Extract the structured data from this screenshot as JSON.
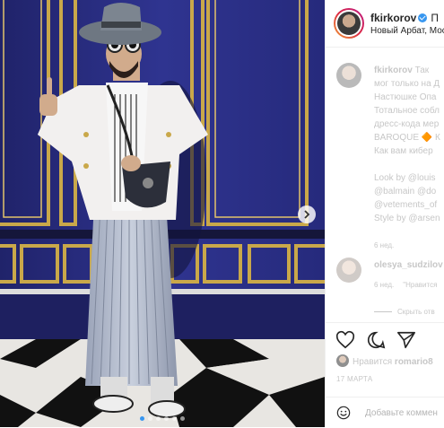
{
  "post": {
    "image_alt": "",
    "carousel": {
      "total": 6,
      "active_index": 0
    }
  },
  "header": {
    "username": "fkirkorov",
    "follow_label": "П",
    "location": "Новый Арбат, Мос"
  },
  "caption": {
    "username": "fkirkorov",
    "lines": [
      "Так",
      "мог только на Д",
      "Настюшке Опа",
      "Тотальное собл",
      "дресс-кода мер",
      "BAROQUE 🔶 К",
      "Как вам кибер"
    ],
    "credits": [
      "Look by @louis",
      "@balmain @do",
      "@vetements_of",
      "Style by @arsen"
    ],
    "time": "6 нед."
  },
  "reply": {
    "username": "olesya_sudzilov",
    "time": "6 нед.",
    "action": "\"Нравится",
    "hide_label": "Скрыть отв"
  },
  "actions": {
    "like_icon": "heart-icon",
    "comment_icon": "comment-icon",
    "share_icon": "send-icon"
  },
  "likes": {
    "prefix": "Нравится",
    "user": "romario8"
  },
  "date": "17 МАРТА",
  "comment_box": {
    "placeholder": "Добавьте коммен"
  },
  "colors": {
    "accent": "#3897f0",
    "wall": "#2a2d7a",
    "gold": "#c9a84a"
  }
}
